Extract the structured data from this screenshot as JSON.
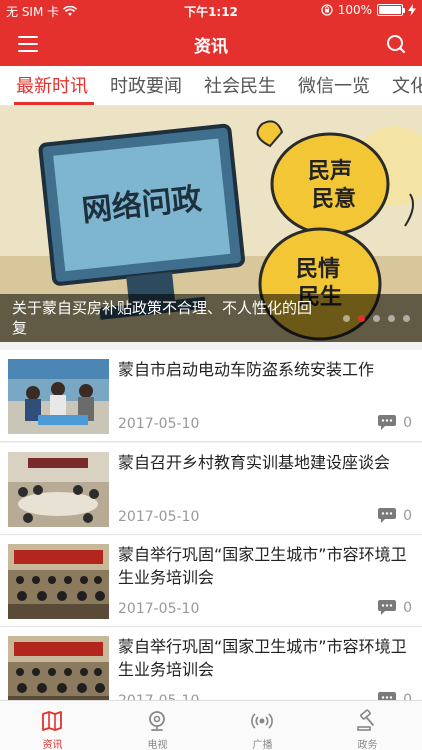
{
  "status_bar": {
    "carrier": "无 SIM 卡",
    "time": "下午1:12",
    "battery": "100%"
  },
  "header": {
    "title": "资讯"
  },
  "tabs": [
    {
      "label": "最新时讯",
      "active": true
    },
    {
      "label": "时政要闻",
      "active": false
    },
    {
      "label": "社会民生",
      "active": false
    },
    {
      "label": "微信一览",
      "active": false
    },
    {
      "label": "文化",
      "active": false
    }
  ],
  "banner": {
    "caption": "关于蒙自买房补贴政策不合理、不人性化的回复",
    "image_text": {
      "screen": "网络问政",
      "bubble1": "民声民意",
      "bubble2": "民情民生"
    },
    "slide_count": 5,
    "active_slide": 2
  },
  "news": [
    {
      "title": "蒙自市启动电动车防盗系统安装工作",
      "date": "2017-05-10",
      "comments": "0"
    },
    {
      "title": "蒙自召开乡村教育实训基地建设座谈会",
      "date": "2017-05-10",
      "comments": "0"
    },
    {
      "title": "蒙自举行巩固“国家卫生城市”市容环境卫生业务培训会",
      "date": "2017-05-10",
      "comments": "0"
    },
    {
      "title": "蒙自举行巩固“国家卫生城市”市容环境卫生业务培训会",
      "date": "2017-05-10",
      "comments": "0"
    }
  ],
  "tabbar": [
    {
      "label": "资讯",
      "icon": "map-icon",
      "active": true
    },
    {
      "label": "电视",
      "icon": "tv-icon",
      "active": false
    },
    {
      "label": "广播",
      "icon": "broadcast-icon",
      "active": false
    },
    {
      "label": "政务",
      "icon": "gavel-icon",
      "active": false
    }
  ],
  "colors": {
    "brand": "#e5312d",
    "date": "#999999"
  }
}
